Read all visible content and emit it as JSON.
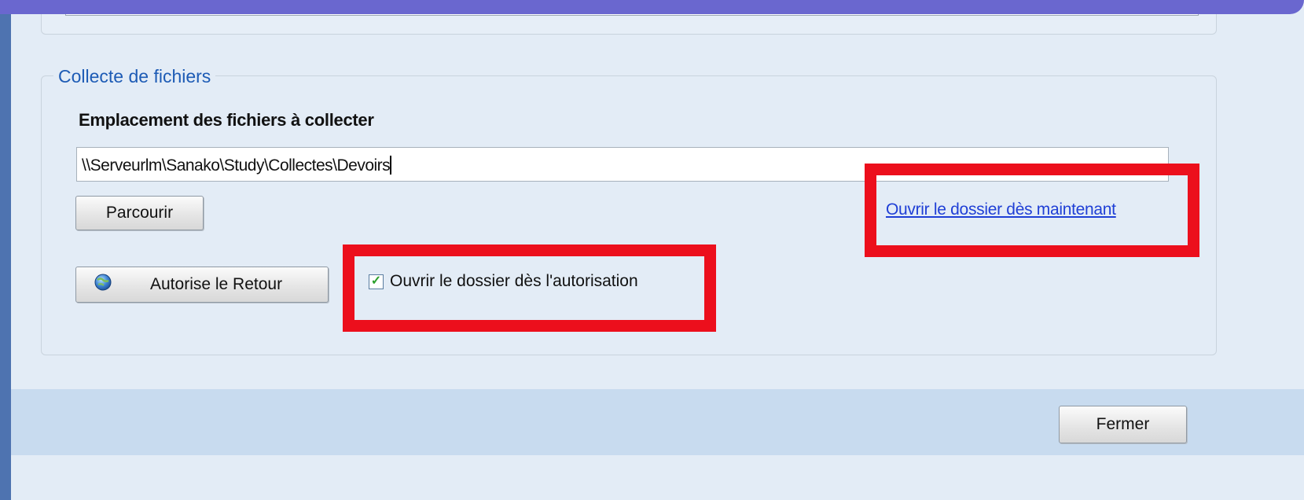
{
  "group": {
    "title": "Collecte de fichiers",
    "location_label": "Emplacement des fichiers à collecter",
    "location_value": "\\\\Serveurlm\\Sanako\\Study\\Collectes\\Devoirs"
  },
  "buttons": {
    "browse": "Parcourir",
    "allow_return": "Autorise le Retour",
    "close": "Fermer"
  },
  "open_now_link": "Ouvrir le dossier dès maintenant",
  "open_on_allow": {
    "label": "Ouvrir le dossier dès l'autorisation",
    "checked": true
  },
  "colors": {
    "highlight": "#ec0f1c",
    "group_title": "#1d5bb5",
    "link": "#1f3fd6"
  },
  "icons": {
    "return_button_icon": "globe-icon",
    "checkbox_mark": "checkmark-icon"
  }
}
